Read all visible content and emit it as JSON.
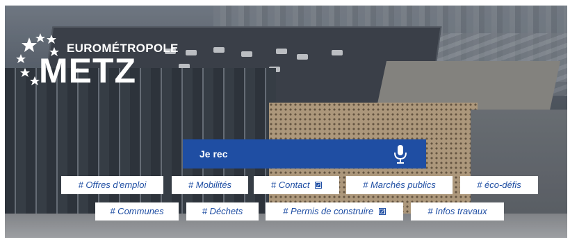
{
  "logo": {
    "top_text": "EUROMÉTROPOLE",
    "main_text": "METZ"
  },
  "search": {
    "value": "Je rec",
    "icon": "microphone-icon"
  },
  "tags": {
    "row1": [
      {
        "label": "# Offres d'emploi",
        "external": false
      },
      {
        "label": "# Mobilités",
        "external": false
      },
      {
        "label": "# Contact",
        "external": true
      },
      {
        "label": "# Marchés publics",
        "external": false
      },
      {
        "label": "# éco-défis",
        "external": false
      }
    ],
    "row2": [
      {
        "label": "# Communes",
        "external": false
      },
      {
        "label": "# Déchets",
        "external": false
      },
      {
        "label": "# Permis de construire",
        "external": true
      },
      {
        "label": "# Infos travaux",
        "external": false
      }
    ]
  },
  "colors": {
    "accent": "#1f4ea3",
    "tag_bg": "#ffffff",
    "logo_text": "#ffffff"
  }
}
